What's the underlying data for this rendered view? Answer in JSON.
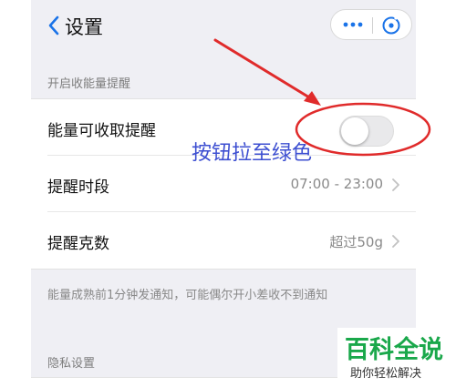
{
  "nav": {
    "back_icon": "chevron-left-icon",
    "title": "设置",
    "menu_icon": "more-dots-icon",
    "close_icon": "close-circle-icon"
  },
  "sections": {
    "energy": {
      "header": "开启收能量提醒",
      "rows": [
        {
          "label": "能量可收取提醒",
          "control": "toggle",
          "toggle_on": false
        },
        {
          "label": "提醒时段",
          "value": "07:00 - 23:00"
        },
        {
          "label": "提醒克数",
          "value": "超过50g"
        }
      ],
      "footnote": "能量成熟前1分钟发通知，可能偶尔开小差收不到通知"
    },
    "privacy": {
      "header": "隐私设置"
    }
  },
  "annotation": {
    "text": "按钮拉至绿色",
    "color": "#e02b2b"
  },
  "watermark": {
    "main": "百科全说",
    "sub": "助你轻松解决"
  },
  "colors": {
    "accent": "#1a73e8",
    "background": "#efeff4",
    "annotation_red": "#e02b2b",
    "annotation_text": "#3d4fd1",
    "watermark_green": "#1aa84b"
  }
}
